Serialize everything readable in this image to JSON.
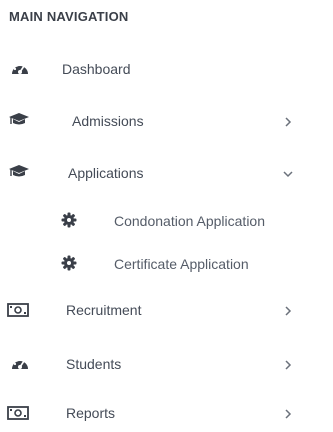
{
  "nav": {
    "heading": "MAIN NAVIGATION",
    "items": [
      {
        "label": "Dashboard",
        "icon": "dashboard-gauge-icon"
      },
      {
        "label": "Admissions",
        "icon": "graduation-cap-icon",
        "chevron": "right"
      },
      {
        "label": "Applications",
        "icon": "graduation-cap-icon",
        "chevron": "down",
        "expanded": true
      },
      {
        "label": "Condonation Application",
        "icon": "gear-icon"
      },
      {
        "label": "Certificate Application",
        "icon": "gear-icon"
      },
      {
        "label": "Recruitment",
        "icon": "money-bill-icon",
        "chevron": "right"
      },
      {
        "label": "Students",
        "icon": "dashboard-gauge-icon",
        "chevron": "right"
      },
      {
        "label": "Reports",
        "icon": "money-bill-icon",
        "chevron": "right"
      }
    ]
  },
  "colors": {
    "text": "#444b57",
    "icon": "#3a3f48",
    "heading": "#3a3f48"
  }
}
